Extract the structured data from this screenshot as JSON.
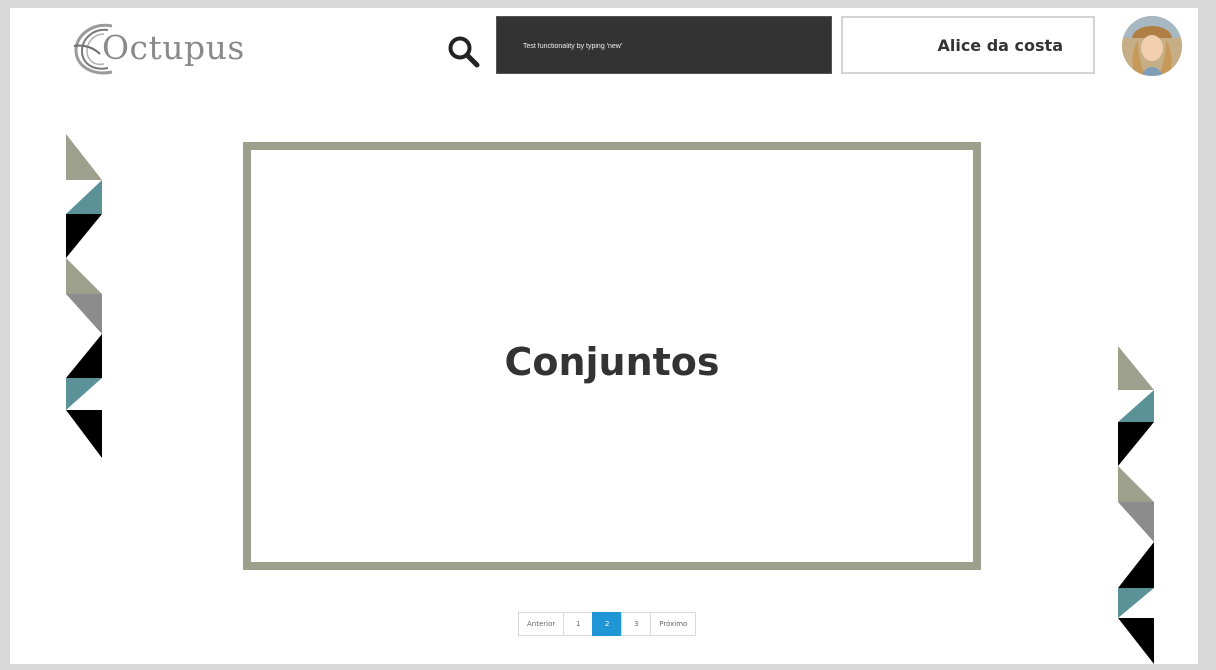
{
  "header": {
    "logo_text": "Octupus",
    "search": {
      "placeholder": "Test functionality by typing 'new'"
    },
    "user": {
      "name": "Alice da costa"
    }
  },
  "main": {
    "card_title": "Conjuntos"
  },
  "pagination": {
    "previous_label": "Anterior",
    "pages": [
      "1",
      "2",
      "3"
    ],
    "active_page": "2",
    "next_label": "Próximo"
  },
  "colors": {
    "card_border": "#9ca08c",
    "search_bg": "#333333",
    "active_page": "#2196d6",
    "deco_sage": "#9ca08c",
    "deco_teal": "#5b9298",
    "deco_black": "#000000",
    "deco_gray": "#8c8c8c"
  },
  "icons": {
    "search": "search-icon",
    "logo": "octupus-logo-icon"
  }
}
